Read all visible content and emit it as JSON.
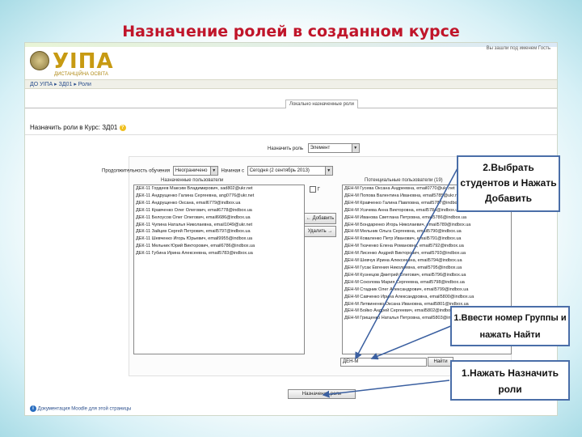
{
  "slide": {
    "title": "Назначение ролей в созданном курсе"
  },
  "moodle": {
    "brand": "УІПА",
    "brand_sub": "ДИСТАНЦІЙНА ОСВІТА",
    "login_info": "Вы зашли под именем Гость",
    "breadcrumb": "ДО УІПА ▸ ЗД01 ▸ Роли",
    "tab_label": "Локально назначенные роли",
    "section_title": "Назначить роли в Курс: ЗД01",
    "role_label": "Назначить роль",
    "role_value": "Элемент",
    "duration_label": "Продолжительность обучения",
    "duration_value": "Неограничено",
    "start_label": "Начиная с",
    "start_value": "Сегодня (2 сентябрь 2013)",
    "existing_label": "Назначенные пользователи",
    "potential_label": "Потенциальные пользователи (19)",
    "hide_label": "Г",
    "add_button": "← Добавить",
    "remove_button": "Удалить →",
    "search_value": "ДЕН-М",
    "search_button": "Найти",
    "assign_button": "Назначение роли",
    "footer_link": "Документация Moodle для этой страницы",
    "assigned_users": [
      "ДЕК-11 Гордеев Максим Владимирович, sad802@ukr.net",
      "ДЕК-11 Андрущенко Галина Сергеевна, ang0776@ukr.net",
      "ДЕК-11 Андрущенко Оксана, email6779@indbox.ua",
      "ДЕК-11 Кравченко Олег Олегович, email6778@indbox.ua",
      "ДЕК-11 Белоусов Олег Олегович, email6686@indbox.ua",
      "ДЕК-11 Чупина Наталья Николаевна, email1049@ukr.net",
      "ДЕК-11 Зайцев Сергей Петрович, email5797@indbox.ua",
      "ДЕК-11 Шевченко Игорь Юрьевич, email9955@indbox.ua",
      "ДЕК-11 Мельник Юрий Викторович, email6786@indbox.ua",
      "ДЕК-11 Губина Ирина Алексеевна, email5783@indbox.ua"
    ],
    "potential_users": [
      "ДЕН-М Гусева Оксана Андреевна, email0770@ukr.net",
      "ДЕН-М Попова Валентина Ивановна, email5785@ukr.net",
      "ДЕН-М Кравченко Галина Павловна, email5787@indbox.ua",
      "ДЕН-М Усачева Анна Викторовна, email5784@indbox.ua",
      "ДЕН-М Иванова Светлана Петровна, email5786@indbox.ua",
      "ДЕН-М Бондаренко Игорь Николаевич, email5789@indbox.ua",
      "ДЕН-М Мельник Ольга Сергеевна, email5790@indbox.ua",
      "ДЕН-М Коваленко Петр Иванович, email5791@indbox.ua",
      "ДЕН-М Ткаченко Елена Романовна, email5792@indbox.ua",
      "ДЕН-М Лисенко Андрей Викторович, email5793@indbox.ua",
      "ДЕН-М Шевчук Ирина Алексеевна, email5794@indbox.ua",
      "ДЕН-М Гусак Евгения Николаевна, email5795@indbox.ua",
      "ДЕН-М Кузнецов Дмитрий Олегович, email5796@indbox.ua",
      "ДЕН-М Соколова Мария Сергеевна, email5798@indbox.ua",
      "ДЕН-М Стадник Олег Александрович, email5799@indbox.ua",
      "ДЕН-М Савченко Ирина Александровна, email5800@indbox.ua",
      "ДЕН-М Литвиненко Оксана Ивановна, email5801@indbox.ua",
      "ДЕН-М Бойко Андрей Сергеевич, email5802@indbox.ua",
      "ДЕН-М Грищенко Наталья Петровна, email5803@indbox.ua"
    ]
  },
  "callouts": {
    "c2": "2.Выбрать студентов и Нажать Добавить",
    "c1": "1.Ввести номер Группы и нажать Найти",
    "c3": "1.Нажать Назначить роли"
  },
  "colors": {
    "title": "#c0152a",
    "brand": "#c79a12",
    "callout_border": "#4a6ea8",
    "arrow": "#3a5fa0"
  }
}
